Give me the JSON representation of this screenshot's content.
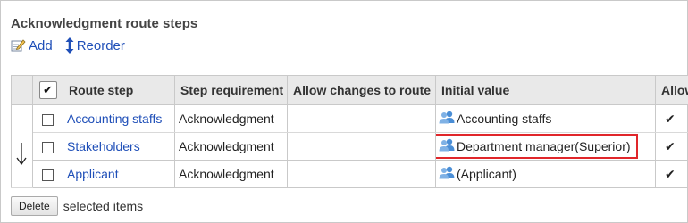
{
  "section": {
    "title": "Acknowledgment route steps"
  },
  "toolbar": {
    "add_label": "Add",
    "reorder_label": "Reorder"
  },
  "table": {
    "headers": {
      "route_step": "Route step",
      "step_requirement": "Step requirement",
      "allow_changes": "Allow changes to route",
      "initial_value": "Initial value",
      "allow_truncated": "Allow"
    },
    "select_all_glyph": "✔",
    "rows": [
      {
        "route_step": "Accounting staffs",
        "requirement": "Acknowledgment",
        "allow_changes": "",
        "initial_value": "Accounting staffs",
        "last_col": "✔"
      },
      {
        "route_step": "Stakeholders",
        "requirement": "Acknowledgment",
        "allow_changes": "",
        "initial_value": "Department manager(Superior)",
        "last_col": "✔"
      },
      {
        "route_step": "Applicant",
        "requirement": "Acknowledgment",
        "allow_changes": "",
        "initial_value": "(Applicant)",
        "last_col": "✔"
      }
    ]
  },
  "footer": {
    "delete_label": "Delete",
    "selected_text": "selected items"
  },
  "icons": {
    "add": "edit-pencil-icon",
    "reorder": "up-down-arrow-icon",
    "user_group": "user-group-icon",
    "order": "down-arrow-icon"
  },
  "colors": {
    "link": "#1f4fb8",
    "header_bg": "#e9e9e9",
    "highlight_border": "#e0262a",
    "user_icon": "#4a8ed6"
  }
}
